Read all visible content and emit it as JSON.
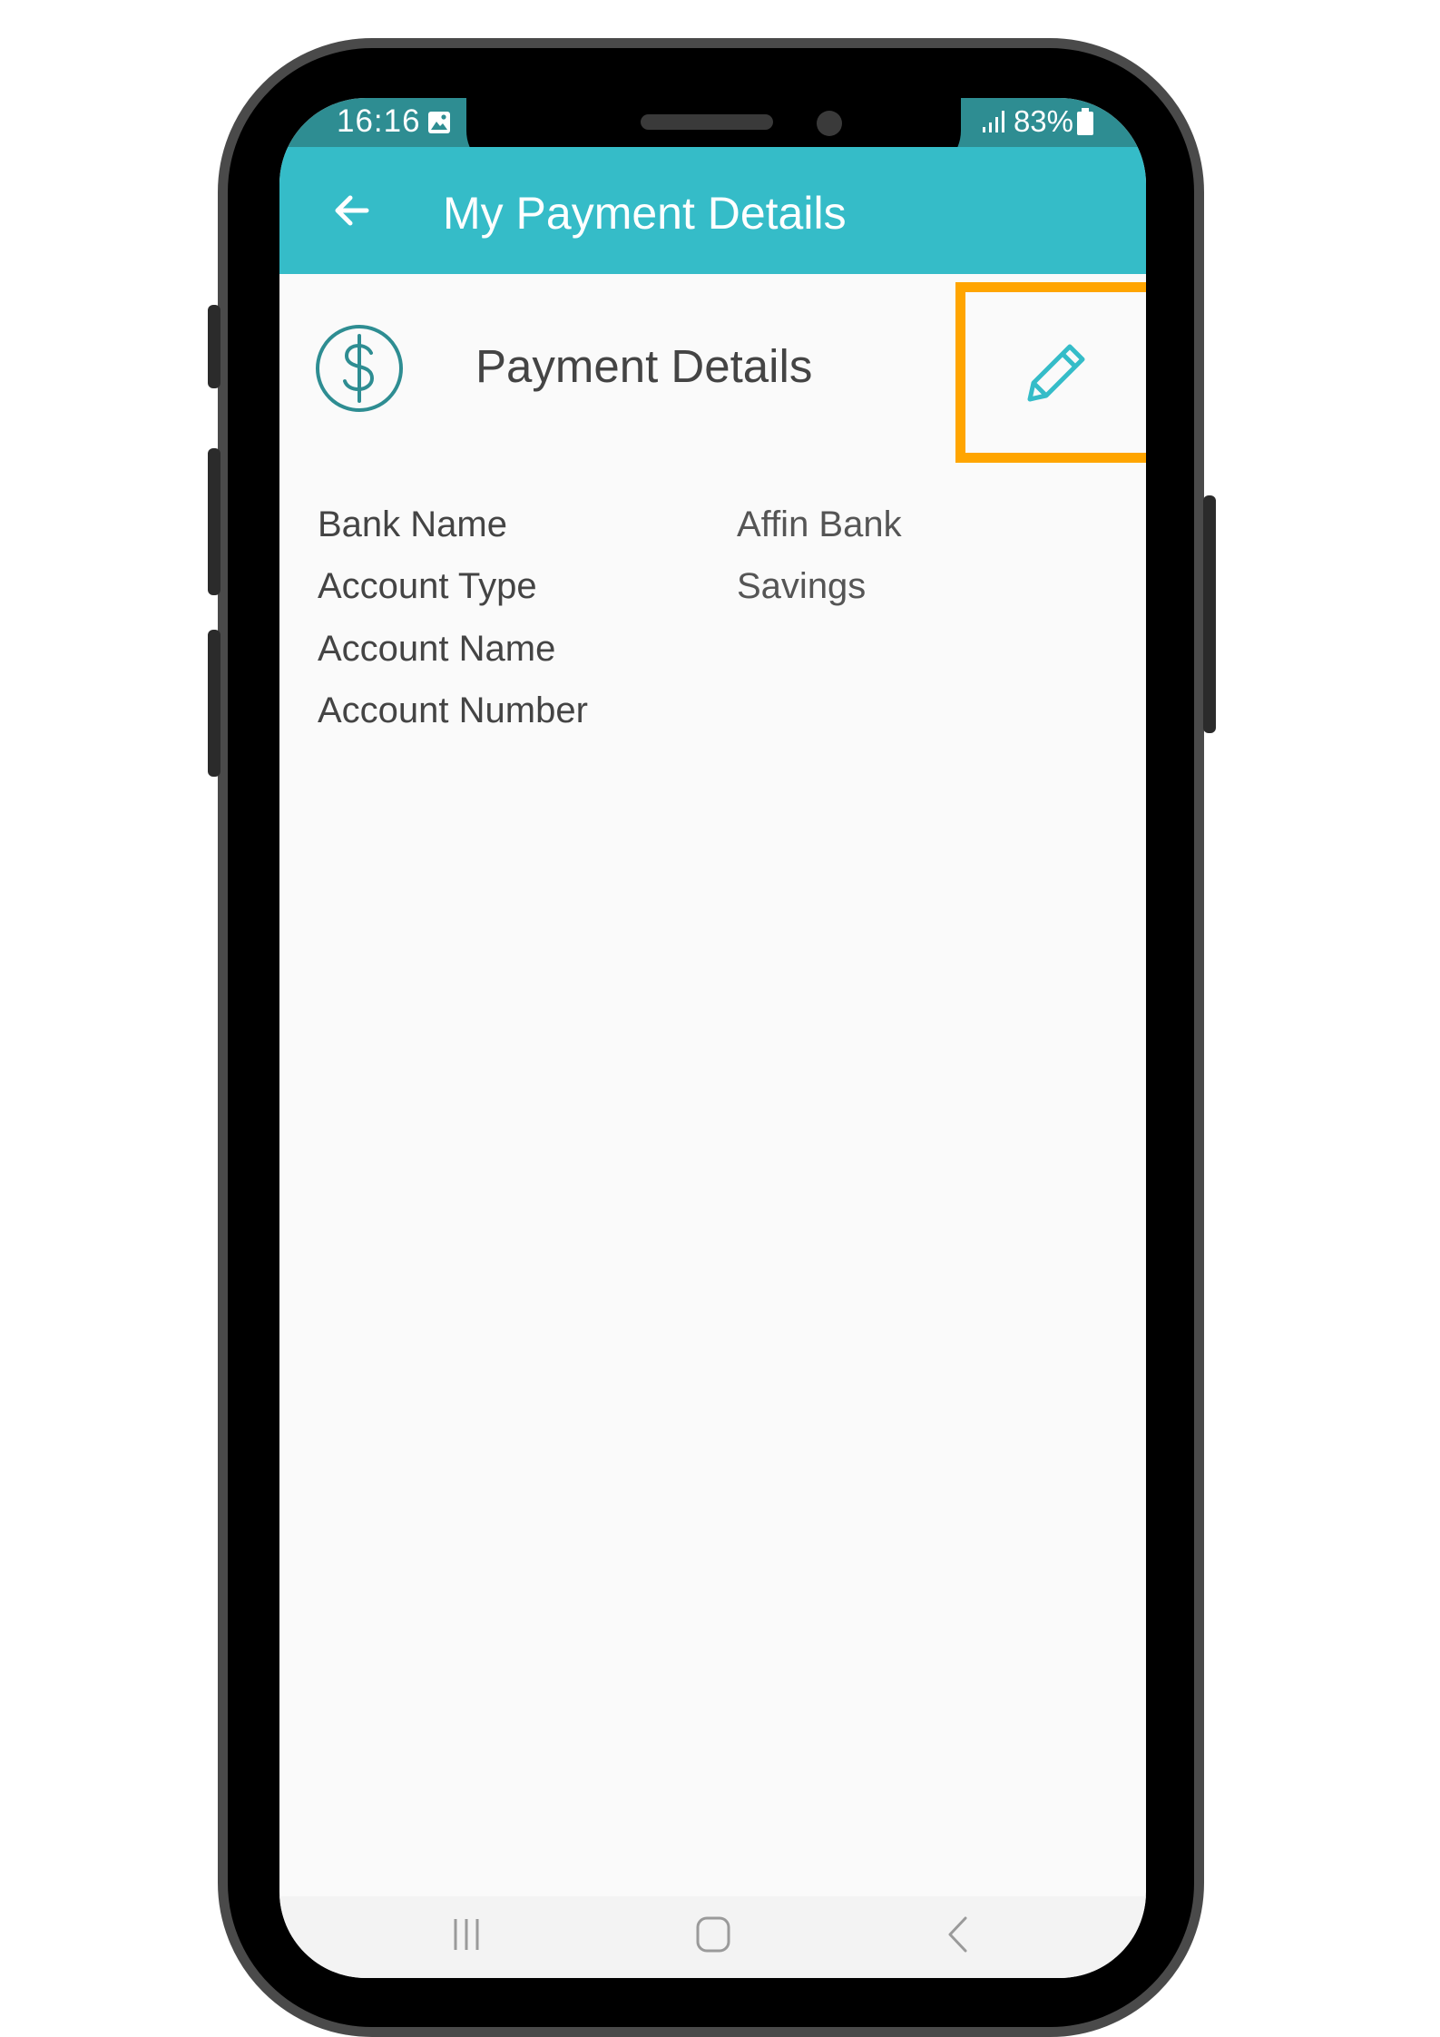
{
  "status_bar": {
    "time": "16:16",
    "battery": "83%",
    "icons": [
      "gallery-icon",
      "signal-icon",
      "battery-icon"
    ]
  },
  "app_bar": {
    "title": "My Payment Details",
    "back_icon": "arrow-left-icon"
  },
  "section": {
    "title": "Payment Details",
    "icon": "dollar-circle-icon",
    "edit_icon": "pencil-icon"
  },
  "details": [
    {
      "label": "Bank Name",
      "value": "Affin Bank"
    },
    {
      "label": "Account Type",
      "value": "Savings"
    },
    {
      "label": "Account Name",
      "value": ""
    },
    {
      "label": "Account Number",
      "value": ""
    }
  ],
  "nav_bar": {
    "icons": [
      "recent-apps-icon",
      "home-icon",
      "back-nav-icon"
    ]
  },
  "colors": {
    "app_bar": "#35bcc8",
    "status_bar": "#2e8d92",
    "accent_icon": "#2e8d92",
    "pencil": "#35bcc8",
    "highlight": "#ffa500",
    "background": "#fafafa"
  }
}
